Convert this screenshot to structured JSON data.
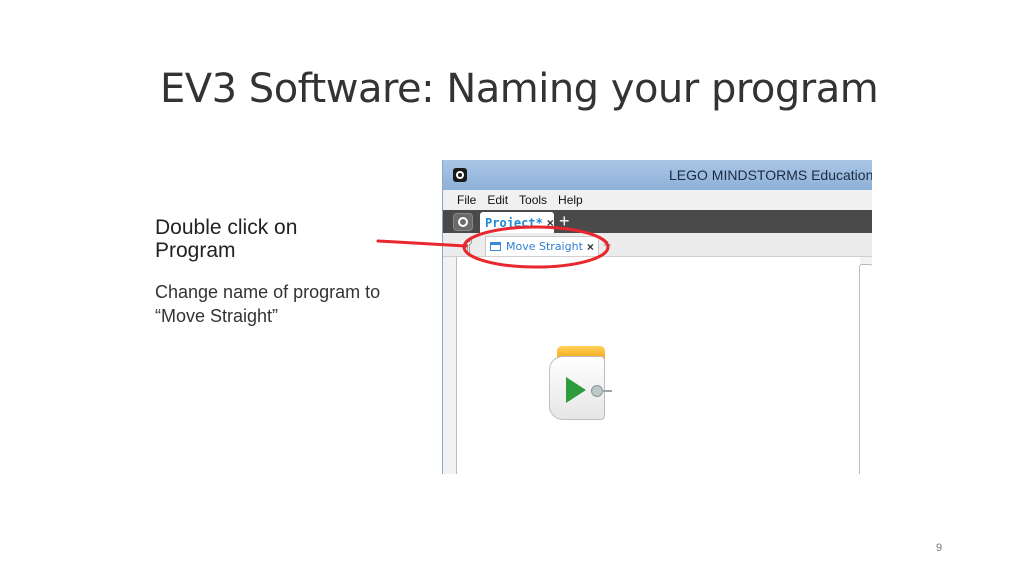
{
  "slide": {
    "title": "EV3 Software: Naming your program",
    "bullet_main": "Double click on Program",
    "bullet_sub": "Change name of program to “Move Straight”",
    "page_number": "9"
  },
  "app": {
    "window_title": "LEGO MINDSTORMS Education",
    "menu": [
      "File",
      "Edit",
      "Tools",
      "Help"
    ],
    "project_tab": {
      "label": "Project*",
      "close": "×",
      "add": "+"
    },
    "program_tab": {
      "label": "Move Straight",
      "close": "×",
      "add": "+"
    }
  },
  "annotation": {
    "color": "#e8262d"
  },
  "icons": [
    "lego-logo-icon",
    "project-gear-icon",
    "wrench-icon",
    "program-tab-icon",
    "play-icon",
    "connector-icon"
  ]
}
